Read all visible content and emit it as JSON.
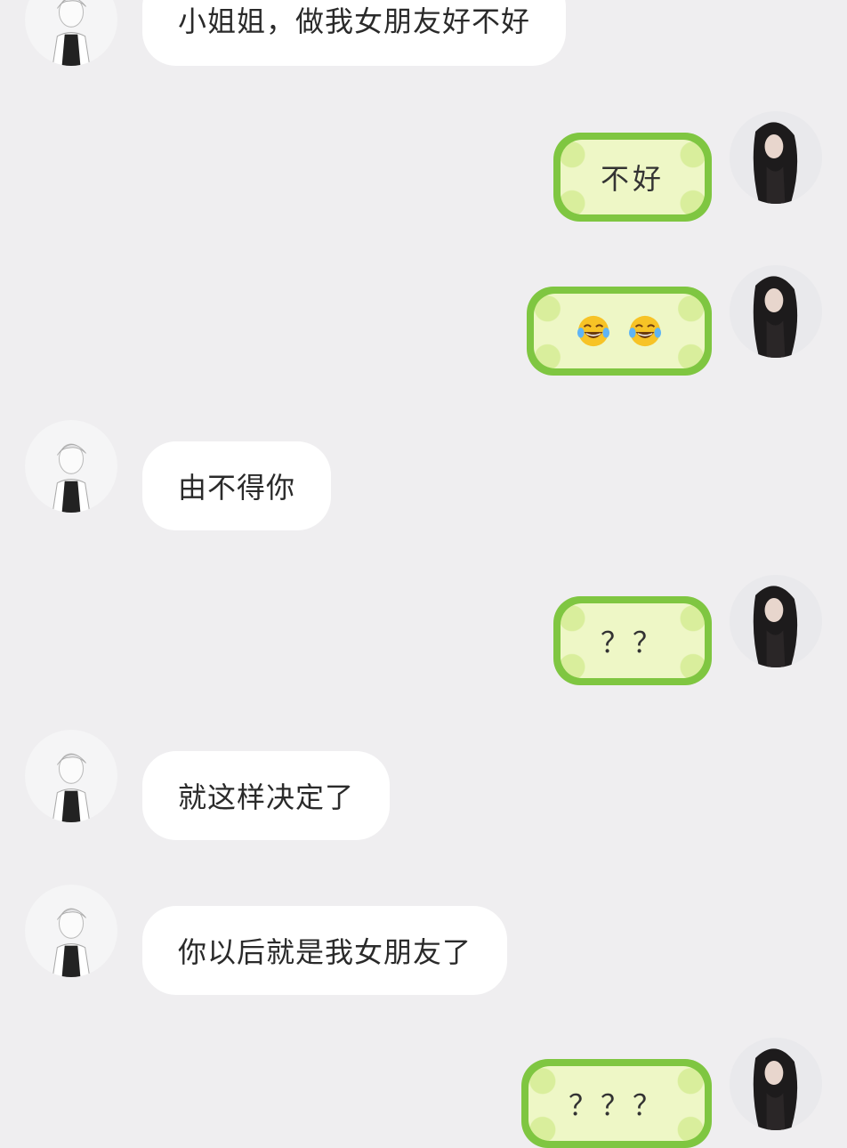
{
  "messages": [
    {
      "side": "left",
      "text": "小姐姐，做我女朋友好不好"
    },
    {
      "side": "right",
      "text": "不好"
    },
    {
      "side": "right",
      "emoji": [
        "face-with-tears-of-joy",
        "face-with-tears-of-joy"
      ]
    },
    {
      "side": "left",
      "text": "由不得你"
    },
    {
      "side": "right",
      "text": "？？"
    },
    {
      "side": "left",
      "text": "就这样决定了"
    },
    {
      "side": "left",
      "text": "你以后就是我女朋友了"
    },
    {
      "side": "right",
      "text": "？？？"
    }
  ],
  "colors": {
    "background": "#efeef0",
    "left_bubble": "#ffffff",
    "right_bubble_border": "#7fc641",
    "right_bubble_fill": "#eef7c6"
  }
}
